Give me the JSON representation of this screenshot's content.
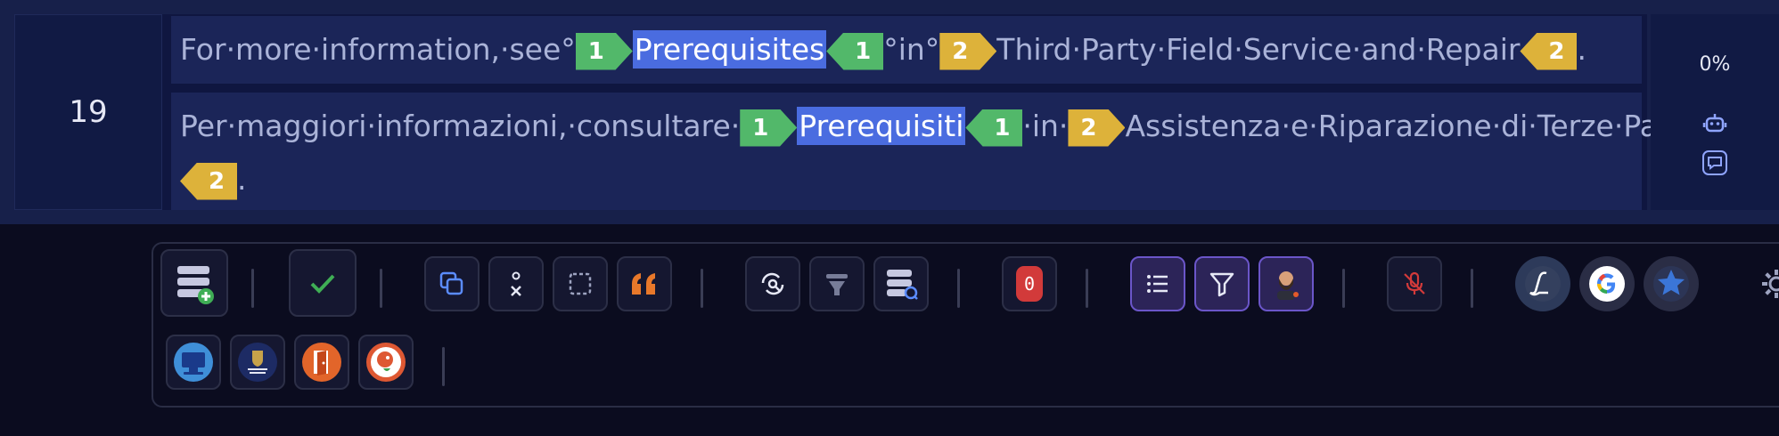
{
  "segment": {
    "number": "19",
    "progress": "0%",
    "source": {
      "before": "For·more·information,·see°",
      "tag1": "1",
      "highlight": "Prerequisites",
      "tag1_close": "1",
      "middle": "°in°",
      "tag2": "2",
      "after": "Third·Party·Field·Service·and·Repair",
      "tag2_close": "2",
      "end": "."
    },
    "target": {
      "before": "Per·maggiori·informazioni,·consultare·",
      "tag1": "1",
      "highlight": "Prerequisiti",
      "tag1_close": "1",
      "middle": "·in·",
      "tag2": "2",
      "after": "Assistenza·e·Riparazione·di·Terze·Parti",
      "tag2_close": "2",
      "end": "."
    }
  },
  "toolbar": {
    "zero_count": "0",
    "colors": {
      "accent": "#4a6ce0",
      "tag_green": "#52b86a",
      "tag_yellow": "#ddb23a",
      "badge_red": "#d23a3a",
      "purple": "#6b56c9"
    }
  }
}
